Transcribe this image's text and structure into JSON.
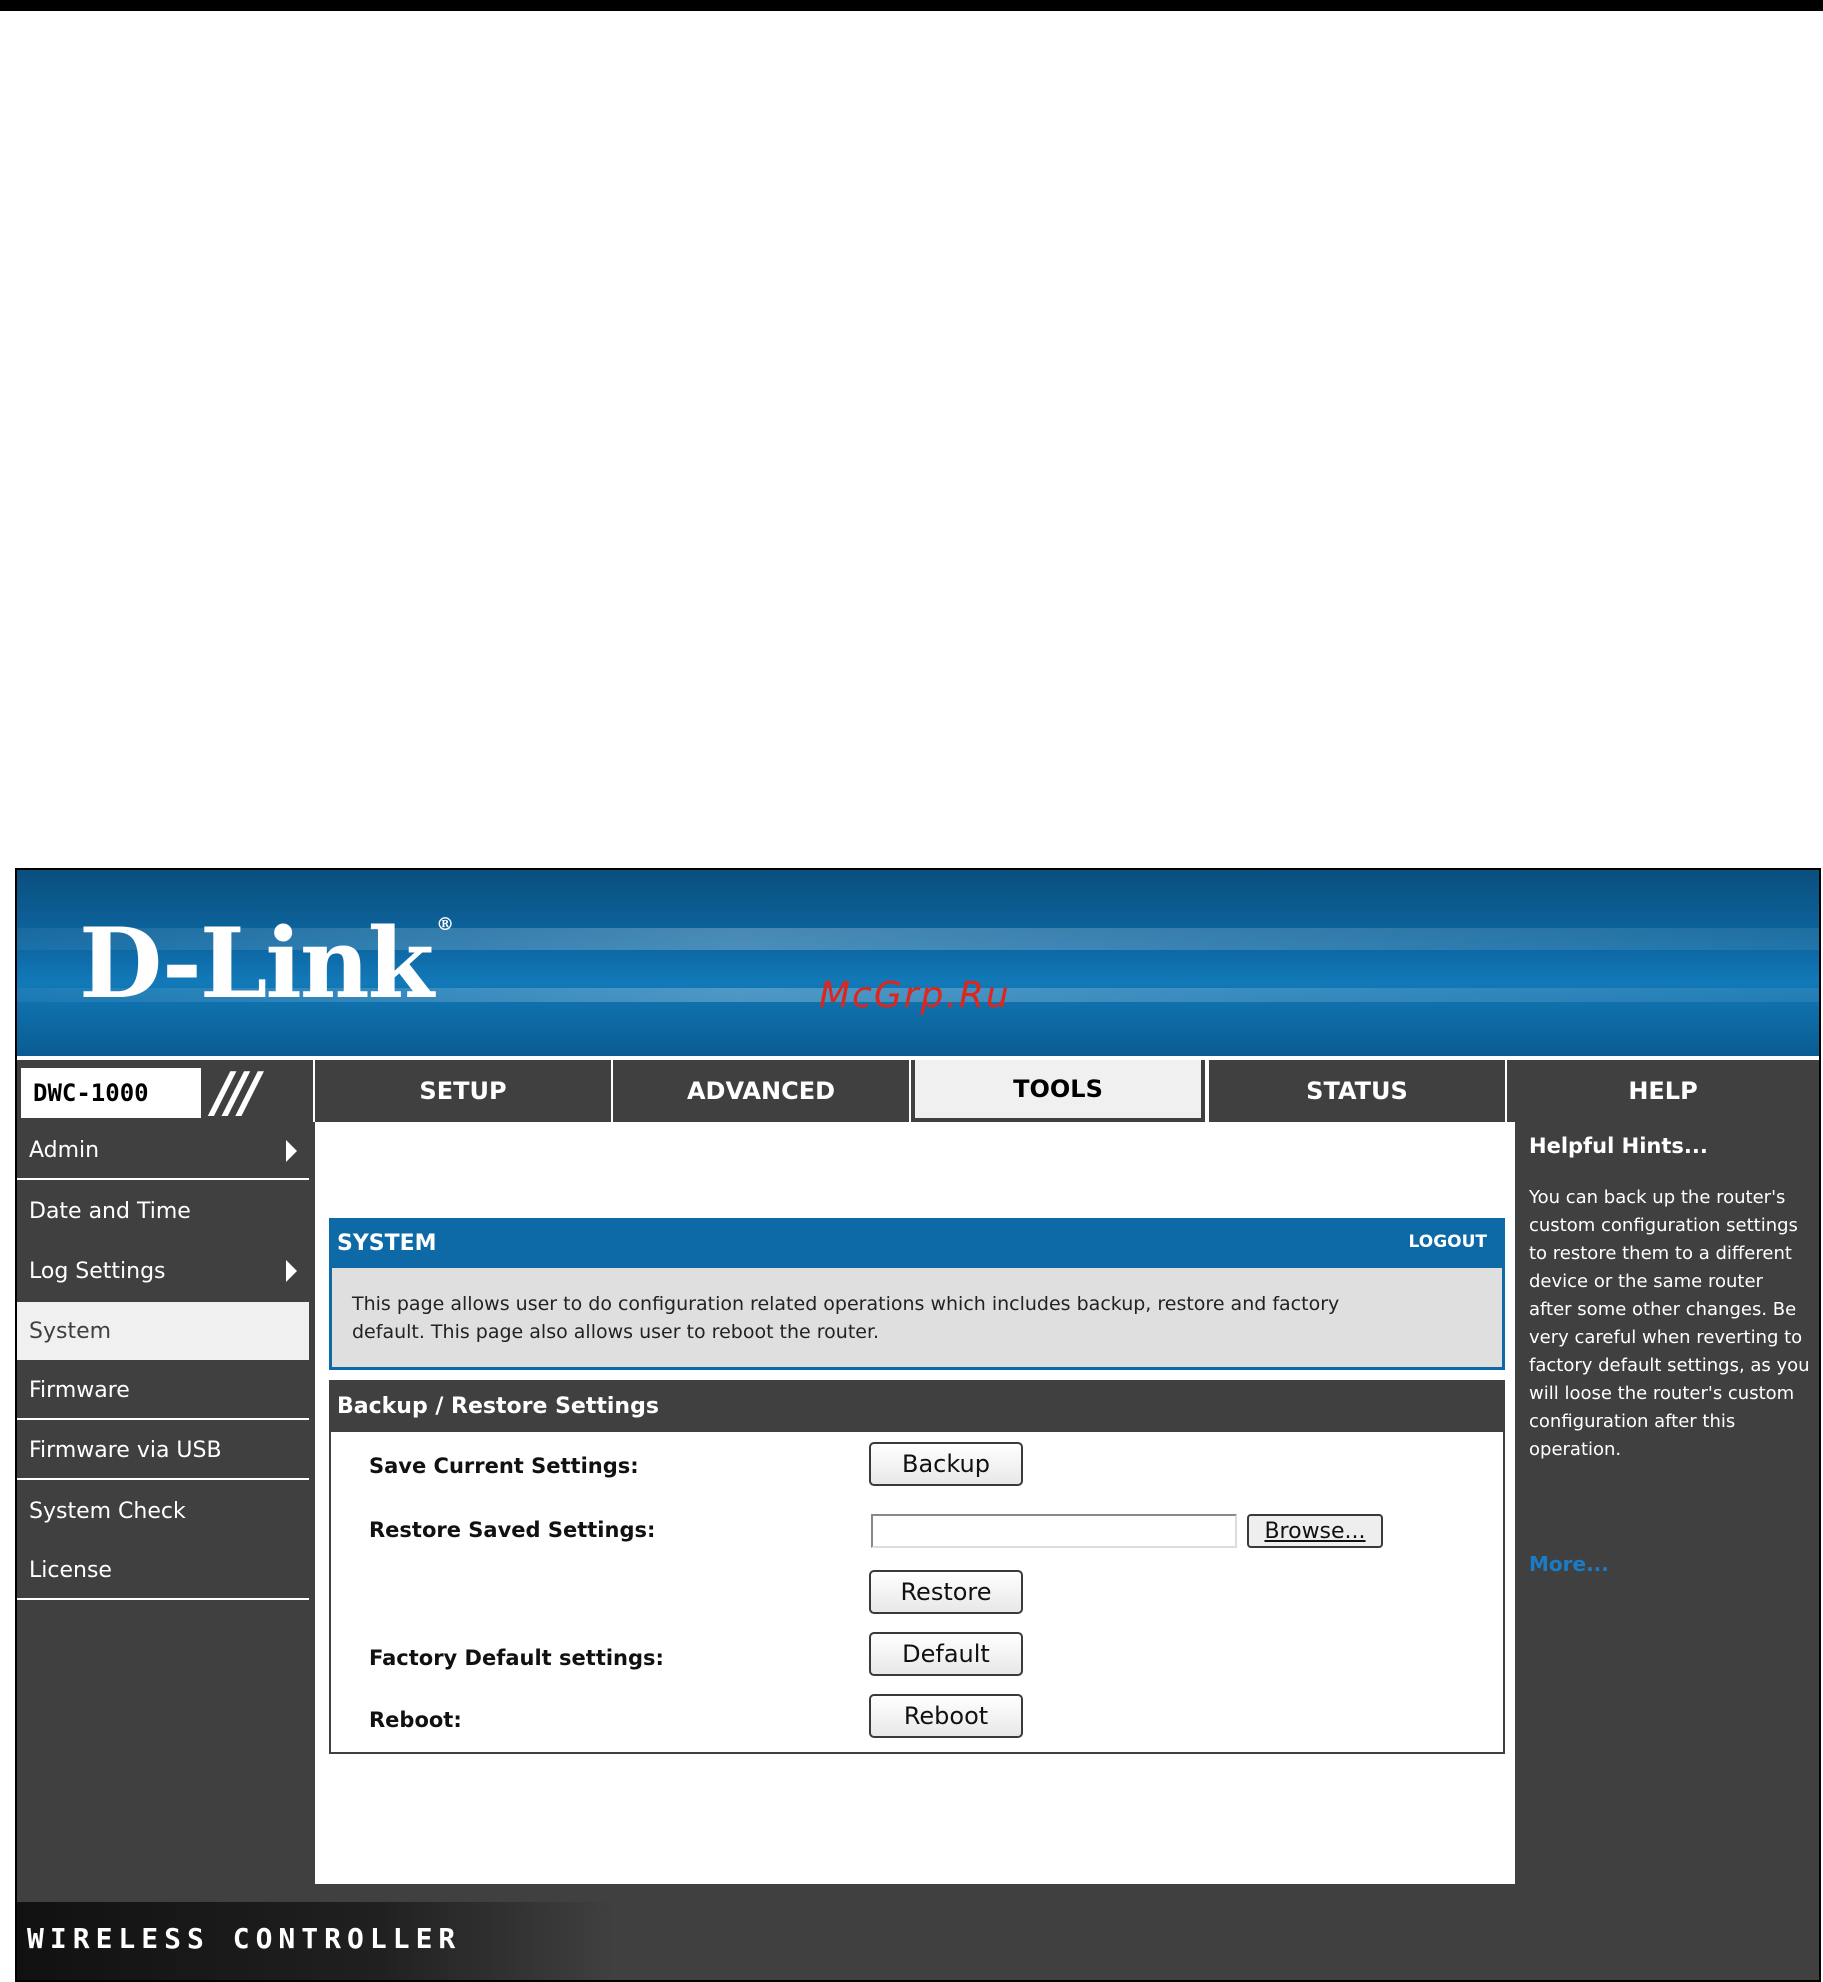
{
  "brand": {
    "logo_text": "D-Link",
    "logo_mark": "®",
    "watermark": "McGrp.Ru"
  },
  "nav": {
    "model": "DWC-1000",
    "tabs": [
      {
        "label": "SETUP"
      },
      {
        "label": "ADVANCED"
      },
      {
        "label": "TOOLS",
        "active": true
      },
      {
        "label": "STATUS"
      },
      {
        "label": "HELP"
      }
    ]
  },
  "sidebar": {
    "items": [
      {
        "label": "Admin",
        "has_submenu": true
      },
      {
        "label": "Date and Time"
      },
      {
        "label": "Log Settings",
        "has_submenu": true
      },
      {
        "label": "System",
        "active": true
      },
      {
        "label": "Firmware"
      },
      {
        "label": "Firmware via USB"
      },
      {
        "label": "System Check"
      },
      {
        "label": "License"
      }
    ]
  },
  "system": {
    "title": "SYSTEM",
    "logout": "LOGOUT",
    "description": "This page allows user to do configuration related operations which includes backup, restore and factory default. This page also allows user to reboot the router."
  },
  "backup": {
    "title": "Backup / Restore Settings",
    "save_label": "Save Current Settings:",
    "backup_button": "Backup",
    "restore_label": "Restore Saved Settings:",
    "file_value": "",
    "browse_button": "Browse...",
    "restore_button": "Restore",
    "factory_label": "Factory Default settings:",
    "default_button": "Default",
    "reboot_label": "Reboot:",
    "reboot_button": "Reboot"
  },
  "help": {
    "title": "Helpful Hints...",
    "text": "You can back up the router's custom configuration settings to restore them to a different device or the same router after some other changes. Be very careful when reverting to factory default settings, as you will loose the router's custom configuration after this operation.",
    "more": "More..."
  },
  "footer": {
    "text": "WIRELESS CONTROLLER"
  },
  "colors": {
    "accent_blue": "#0d6aa6",
    "panel_gray": "#404040",
    "light_gray": "#dfdfdf",
    "watermark_red": "#e0251b"
  }
}
